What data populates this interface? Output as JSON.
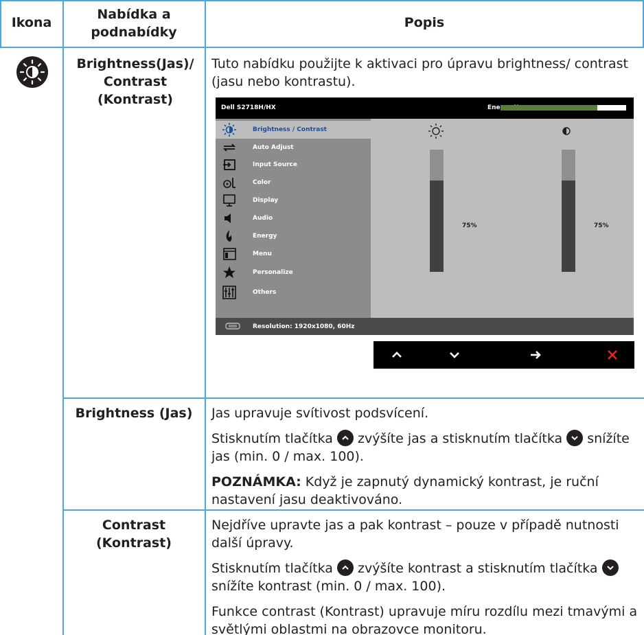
{
  "table": {
    "headers": {
      "icon": "Ikona",
      "menu": "Nabídka a podnabídky",
      "desc": "Popis"
    },
    "main_item": {
      "label": "Brightness(Jas)/ Contrast (Kontrast)",
      "description": "Tuto nabídku použijte k aktivaci pro úpravu brightness/ contrast (jasu nebo kontrastu)."
    },
    "rows": [
      {
        "label": "Brightness (Jas)",
        "p1": "Jas upravuje svítivost podsvícení.",
        "p2a": "Stisknutím tlačítka",
        "p2b": "zvýšíte jas a stisknutím tlačítka",
        "p2c": "snížíte jas (min. 0 / max. 100).",
        "note_label": "POZNÁMKA:",
        "note": "Když je zapnutý dynamický kontrast, je ruční nastavení jasu deaktivováno."
      },
      {
        "label": "Contrast (Kontrast)",
        "p1": "Nejdříve upravte jas a pak kontrast – pouze v případě nutnosti další úpravy.",
        "p2a": "Stisknutím tlačítka",
        "p2b": "zvýšíte kontrast a stisknutím tlačítka",
        "p2c": "snížíte kontrast (min. 0 / max. 100).",
        "p3": "Funkce contrast (Kontrast) upravuje míru rozdílu mezi tmavými a světlými oblastmi na obrazovce monitoru."
      }
    ]
  },
  "osd": {
    "model": "Dell S2718H/HX",
    "energy_label": "Energy Use",
    "energy_level": 0.77,
    "menu_items": [
      {
        "label": "Brightness / Contrast",
        "icon": "brightness-icon",
        "active": true
      },
      {
        "label": "Auto Adjust",
        "icon": "auto-adjust-icon"
      },
      {
        "label": "Input Source",
        "icon": "input-source-icon"
      },
      {
        "label": "Color",
        "icon": "color-icon"
      },
      {
        "label": "Display",
        "icon": "display-icon"
      },
      {
        "label": "Audio",
        "icon": "audio-icon"
      },
      {
        "label": "Energy",
        "icon": "energy-icon"
      },
      {
        "label": "Menu",
        "icon": "menu-icon"
      },
      {
        "label": "Personalize",
        "icon": "star-icon"
      },
      {
        "label": "Others",
        "icon": "others-icon"
      }
    ],
    "brightness_value": "75%",
    "brightness_level": 0.75,
    "contrast_value": "75%",
    "contrast_level": 0.75,
    "resolution": "Resolution: 1920x1080, 60Hz"
  },
  "nav_buttons": [
    "up-arrow-icon",
    "down-arrow-icon",
    "right-arrow-icon",
    "close-icon"
  ],
  "colors": {
    "table_line": "#4aa9d8",
    "osd_selected": "#1a4fa0",
    "energy_fill": "#5a7d3c",
    "close_red": "#e0262a"
  }
}
